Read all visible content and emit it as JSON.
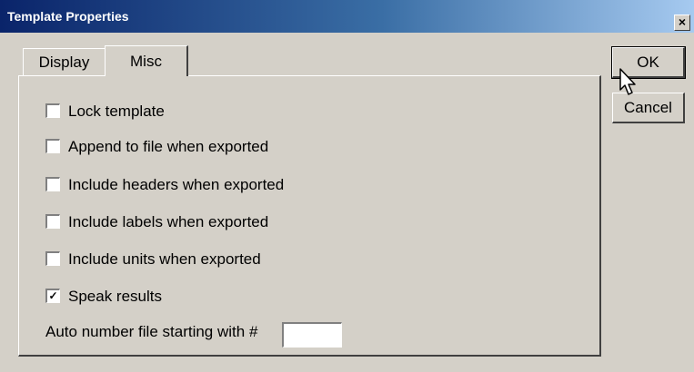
{
  "window": {
    "title": "Template Properties",
    "close_symbol": "×"
  },
  "tabs": [
    {
      "label": "Display",
      "active": false
    },
    {
      "label": "Misc",
      "active": true
    }
  ],
  "options": [
    {
      "label": "Lock template",
      "checked": false
    },
    {
      "label": "Append to file when exported",
      "checked": false
    },
    {
      "label": "Include headers when exported",
      "checked": false
    },
    {
      "label": "Include labels when exported",
      "checked": false
    },
    {
      "label": "Include units when exported",
      "checked": false
    },
    {
      "label": "Speak results",
      "checked": true
    }
  ],
  "auto_number": {
    "label": "Auto number file starting with #",
    "value": ""
  },
  "buttons": {
    "ok_label": "OK",
    "cancel_label": "Cancel"
  },
  "check_mark": "✓"
}
